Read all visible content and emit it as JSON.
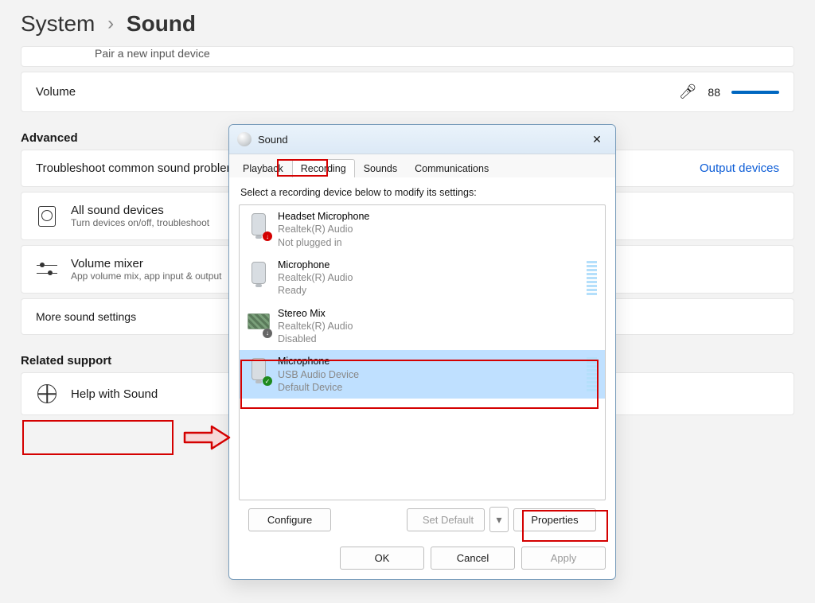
{
  "breadcrumb": {
    "parent": "System",
    "sep": "›",
    "current": "Sound"
  },
  "top_clip": "Pair a new input device",
  "volume": {
    "label": "Volume",
    "value": "88"
  },
  "section_advanced": "Advanced",
  "cards": {
    "troubleshoot": {
      "title": "Troubleshoot common sound problems",
      "right": "Output devices"
    },
    "all_devices": {
      "title": "All sound devices",
      "sub": "Turn devices on/off, troubleshoot"
    },
    "mixer": {
      "title": "Volume mixer",
      "sub": "App volume mix, app input & output"
    },
    "more": "More sound settings"
  },
  "section_related": "Related support",
  "help_card": {
    "title": "Help with Sound"
  },
  "dialog": {
    "title": "Sound",
    "tabs": [
      "Playback",
      "Recording",
      "Sounds",
      "Communications"
    ],
    "active_tab": "Recording",
    "hint": "Select a recording device below to modify its settings:",
    "devices": [
      {
        "name": "Headset Microphone",
        "driver": "Realtek(R) Audio",
        "status": "Not plugged in",
        "icon": "mic",
        "badge": "red",
        "meter": false
      },
      {
        "name": "Microphone",
        "driver": "Realtek(R) Audio",
        "status": "Ready",
        "icon": "mic",
        "badge": null,
        "meter": true
      },
      {
        "name": "Stereo Mix",
        "driver": "Realtek(R) Audio",
        "status": "Disabled",
        "icon": "mix",
        "badge": "down",
        "meter": false
      },
      {
        "name": "Microphone",
        "driver": "USB Audio Device",
        "status": "Default Device",
        "icon": "mic",
        "badge": "ok",
        "meter": true,
        "selected": true
      }
    ],
    "buttons": {
      "configure": "Configure",
      "set_default": "Set Default",
      "properties": "Properties",
      "ok": "OK",
      "cancel": "Cancel",
      "apply": "Apply"
    }
  },
  "annotations": {
    "recording_tab_box": true,
    "selected_device_box": true,
    "properties_box": true,
    "more_settings_box": true,
    "arrow": true
  }
}
